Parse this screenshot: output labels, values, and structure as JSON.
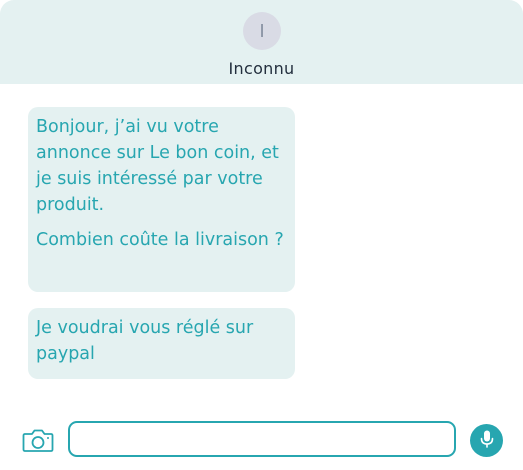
{
  "header": {
    "avatar_initial": "I",
    "contact_name": "Inconnu"
  },
  "messages": [
    {
      "paragraphs": [
        "Bonjour, j’ai vu votre annonce sur Le bon coin, et je suis intéressé par votre produit.",
        "Combien coûte la livraison ?"
      ]
    },
    {
      "paragraphs": [
        "Je voudrai vous réglé sur paypal"
      ]
    }
  ],
  "composer": {
    "input_value": "",
    "input_placeholder": "",
    "camera_icon": "camera-icon",
    "mic_icon": "microphone-icon"
  },
  "colors": {
    "accent": "#27a6b0",
    "bubble_bg": "#e4f1f1",
    "header_bg": "#e4f1f1",
    "avatar_bg": "#d9dbe5",
    "name_text": "#232f3e"
  }
}
